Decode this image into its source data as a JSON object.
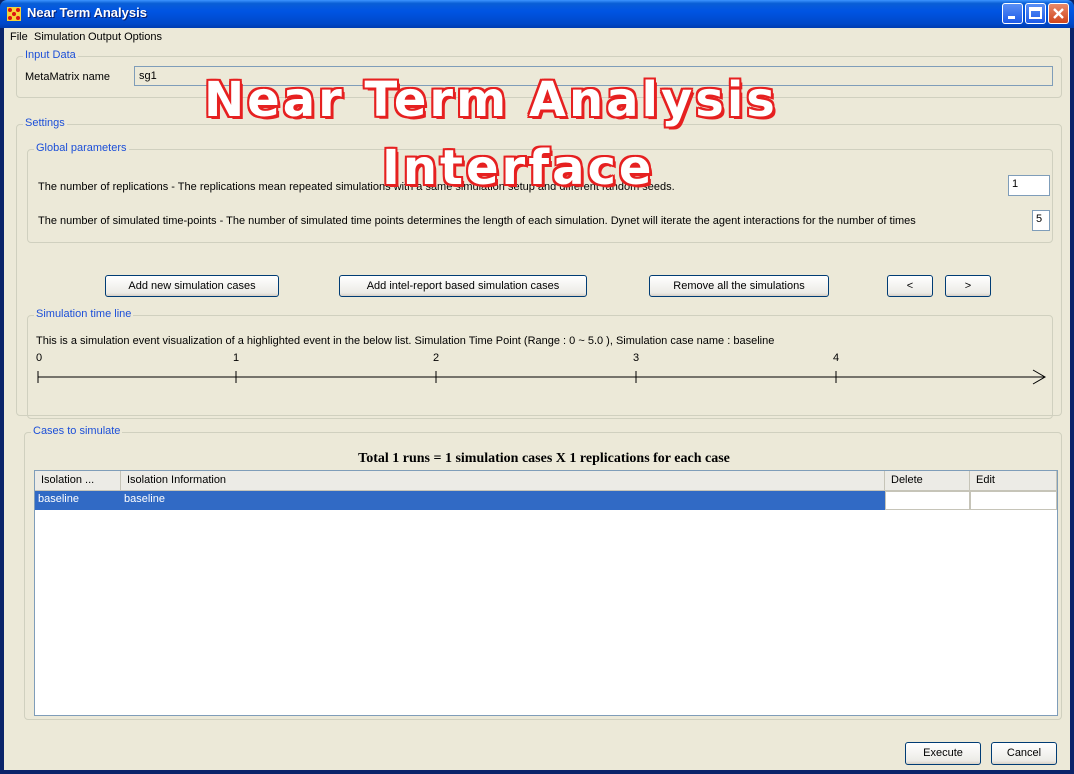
{
  "window": {
    "title": "Near Term Analysis",
    "icon": "network-app-icon",
    "controls": [
      "minimize-icon",
      "maximize-icon",
      "close-icon"
    ]
  },
  "menu": [
    "File",
    "Simulation",
    "Output Options"
  ],
  "overlay": {
    "line1": "Near Term Analysis",
    "line2": "Interface"
  },
  "input_data": {
    "legend": "Input Data",
    "metamatrix_label": "MetaMatrix name",
    "metamatrix_value": "sg1"
  },
  "settings": {
    "legend": "Settings",
    "global_legend": "Global parameters",
    "replications_label": "The number of replications - The replications mean repeated simulations with a same simulation setup and different random seeds.",
    "replications_value": "1",
    "timepoints_label": "The number of simulated time-points - The number of simulated time points determines the length of each simulation. Dynet will iterate the agent interactions for the number of times",
    "timepoints_value": "5"
  },
  "buttons": {
    "add_new": "Add new simulation cases",
    "add_intel": "Add intel-report based simulation cases",
    "remove_all": "Remove all the simulations",
    "prev": "<",
    "next": ">"
  },
  "timeline": {
    "legend": "Simulation time line",
    "description": "This is a simulation event visualization of a highlighted event in the below list. Simulation Time Point (Range : 0 ~ 5.0 ), Simulation case name : baseline",
    "ticks": [
      "0",
      "1",
      "2",
      "3",
      "4"
    ]
  },
  "cases": {
    "legend": "Cases to simulate",
    "summary": "Total 1 runs = 1 simulation cases X 1 replications for each case",
    "columns": [
      "Isolation ...",
      "Isolation Information",
      "Delete",
      "Edit"
    ],
    "rows": [
      {
        "name": "baseline",
        "info": "baseline",
        "delete": "",
        "edit": ""
      }
    ]
  },
  "footer": {
    "execute": "Execute",
    "cancel": "Cancel"
  },
  "colors": {
    "titlebar": "#0054e3",
    "selection": "#316ac5",
    "legend_text": "#1c4fd8",
    "overlay_stroke": "#e62020"
  }
}
